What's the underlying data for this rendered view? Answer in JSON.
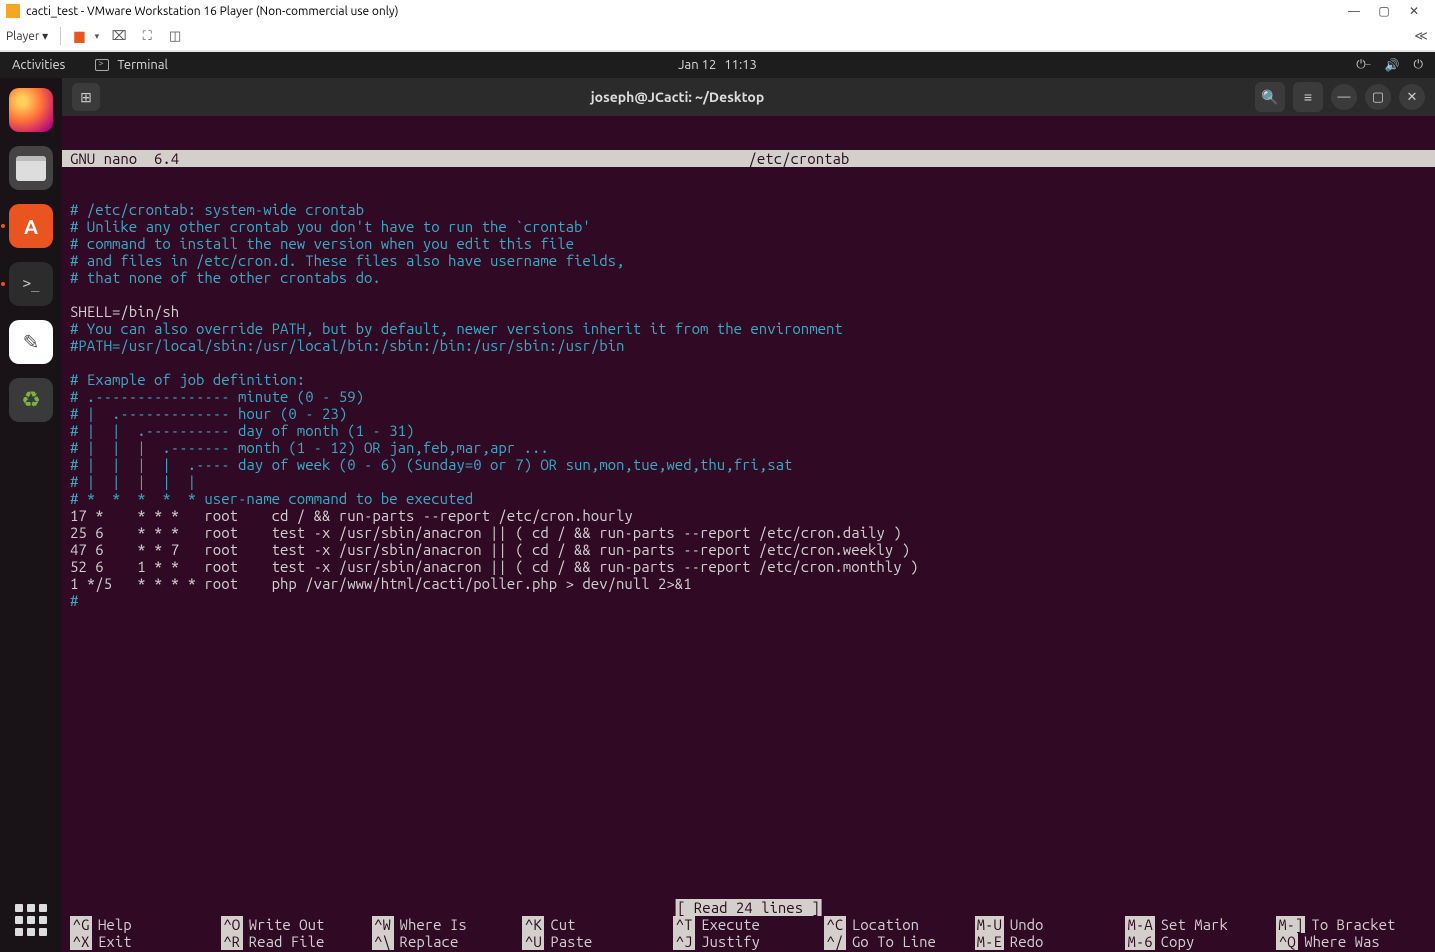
{
  "vmware": {
    "title": "cacti_test - VMware Workstation 16 Player (Non-commercial use only)",
    "player_label": "Player ▾",
    "min": "—",
    "max": "▢",
    "close": "✕",
    "right_chevrons": "≪"
  },
  "gnome": {
    "activities": "Activities",
    "terminal_label": "Terminal",
    "date": "Jan 12",
    "time": "11:13"
  },
  "term_header": {
    "new_tab": "⊞",
    "title": "joseph@JCacti: ~/Desktop",
    "search": "⌕",
    "menu": "≡",
    "minimize": "—",
    "maximize": "▢",
    "close": "✕"
  },
  "nano": {
    "version": "GNU nano  6.4",
    "filename": "/etc/crontab",
    "status": "[ Read 24 lines ]",
    "lines": [
      {
        "t": "comment",
        "s": "# /etc/crontab: system-wide crontab"
      },
      {
        "t": "comment",
        "s": "# Unlike any other crontab you don't have to run the `crontab'"
      },
      {
        "t": "comment",
        "s": "# command to install the new version when you edit this file"
      },
      {
        "t": "comment",
        "s": "# and files in /etc/cron.d. These files also have username fields,"
      },
      {
        "t": "comment",
        "s": "# that none of the other crontabs do."
      },
      {
        "t": "plain",
        "s": ""
      },
      {
        "t": "plain",
        "s": "SHELL=/bin/sh"
      },
      {
        "t": "comment",
        "s": "# You can also override PATH, but by default, newer versions inherit it from the environment"
      },
      {
        "t": "comment",
        "s": "#PATH=/usr/local/sbin:/usr/local/bin:/sbin:/bin:/usr/sbin:/usr/bin"
      },
      {
        "t": "plain",
        "s": ""
      },
      {
        "t": "comment",
        "s": "# Example of job definition:"
      },
      {
        "t": "comment",
        "s": "# .---------------- minute (0 - 59)"
      },
      {
        "t": "comment",
        "s": "# |  .------------- hour (0 - 23)"
      },
      {
        "t": "comment",
        "s": "# |  |  .---------- day of month (1 - 31)"
      },
      {
        "t": "comment",
        "s": "# |  |  |  .------- month (1 - 12) OR jan,feb,mar,apr ..."
      },
      {
        "t": "comment",
        "s": "# |  |  |  |  .---- day of week (0 - 6) (Sunday=0 or 7) OR sun,mon,tue,wed,thu,fri,sat"
      },
      {
        "t": "comment",
        "s": "# |  |  |  |  |"
      },
      {
        "t": "comment",
        "s": "# *  *  *  *  * user-name command to be executed"
      },
      {
        "t": "plain",
        "s": "17 *    * * *   root    cd / && run-parts --report /etc/cron.hourly"
      },
      {
        "t": "plain",
        "s": "25 6    * * *   root    test -x /usr/sbin/anacron || ( cd / && run-parts --report /etc/cron.daily )"
      },
      {
        "t": "plain",
        "s": "47 6    * * 7   root    test -x /usr/sbin/anacron || ( cd / && run-parts --report /etc/cron.weekly )"
      },
      {
        "t": "plain",
        "s": "52 6    1 * *   root    test -x /usr/sbin/anacron || ( cd / && run-parts --report /etc/cron.monthly )"
      },
      {
        "t": "plain",
        "s": "1 */5   * * * * root    php /var/www/html/cacti/poller.php > dev/null 2>&1"
      },
      {
        "t": "comment",
        "s": "#"
      }
    ],
    "shortcuts": [
      {
        "key": "^G",
        "label": "Help"
      },
      {
        "key": "^X",
        "label": "Exit"
      },
      {
        "key": "^O",
        "label": "Write Out"
      },
      {
        "key": "^R",
        "label": "Read File"
      },
      {
        "key": "^W",
        "label": "Where Is"
      },
      {
        "key": "^\\",
        "label": "Replace"
      },
      {
        "key": "^K",
        "label": "Cut"
      },
      {
        "key": "^U",
        "label": "Paste"
      },
      {
        "key": "^T",
        "label": "Execute"
      },
      {
        "key": "^J",
        "label": "Justify"
      },
      {
        "key": "^C",
        "label": "Location"
      },
      {
        "key": "^/",
        "label": "Go To Line"
      },
      {
        "key": "M-U",
        "label": "Undo"
      },
      {
        "key": "M-E",
        "label": "Redo"
      },
      {
        "key": "M-A",
        "label": "Set Mark"
      },
      {
        "key": "M-6",
        "label": "Copy"
      },
      {
        "key": "M-]",
        "label": "To Bracket"
      },
      {
        "key": "^Q",
        "label": "Where Was"
      }
    ]
  }
}
